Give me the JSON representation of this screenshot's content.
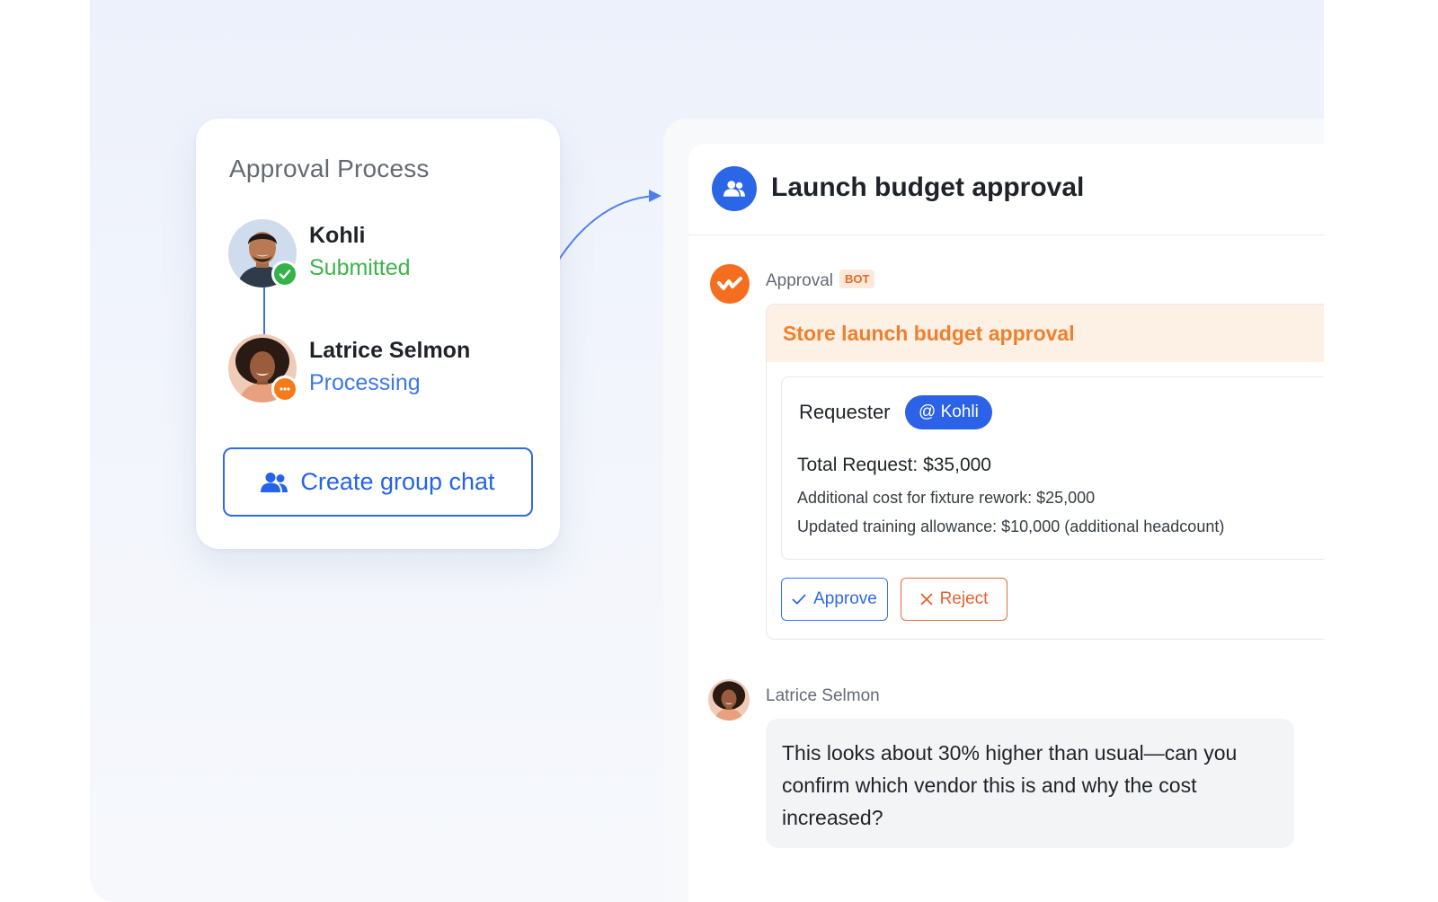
{
  "approval_process": {
    "title": "Approval Process",
    "steps": [
      {
        "name": "Kohli",
        "status": "Submitted",
        "status_color": "#3bb54a",
        "badge_icon": "check-icon"
      },
      {
        "name": "Latrice Selmon",
        "status": "Processing",
        "status_color": "#3d78e8",
        "badge_icon": "more-dots-icon"
      }
    ],
    "create_group_chat_label": "Create group chat"
  },
  "chat": {
    "title": "Launch budget approval",
    "bot_message": {
      "sender": "Approval",
      "badge": "BOT",
      "card_title": "Store launch budget approval",
      "requester_label": "Requester",
      "requester_mention": "@ Kohli",
      "total_request": "Total Request: $35,000",
      "details": [
        "Additional cost for fixture rework: $25,000",
        "Updated training allowance: $10,000 (additional headcount)"
      ],
      "approve_label": "Approve",
      "reject_label": "Reject"
    },
    "user_message": {
      "sender": "Latrice Selmon",
      "text": "This looks about 30% higher than usual—can you confirm which vendor this is and why the cost increased?"
    }
  },
  "colors": {
    "primary": "#2b66e6",
    "bot_accent": "#f56e1f",
    "reject": "#e2622f"
  }
}
